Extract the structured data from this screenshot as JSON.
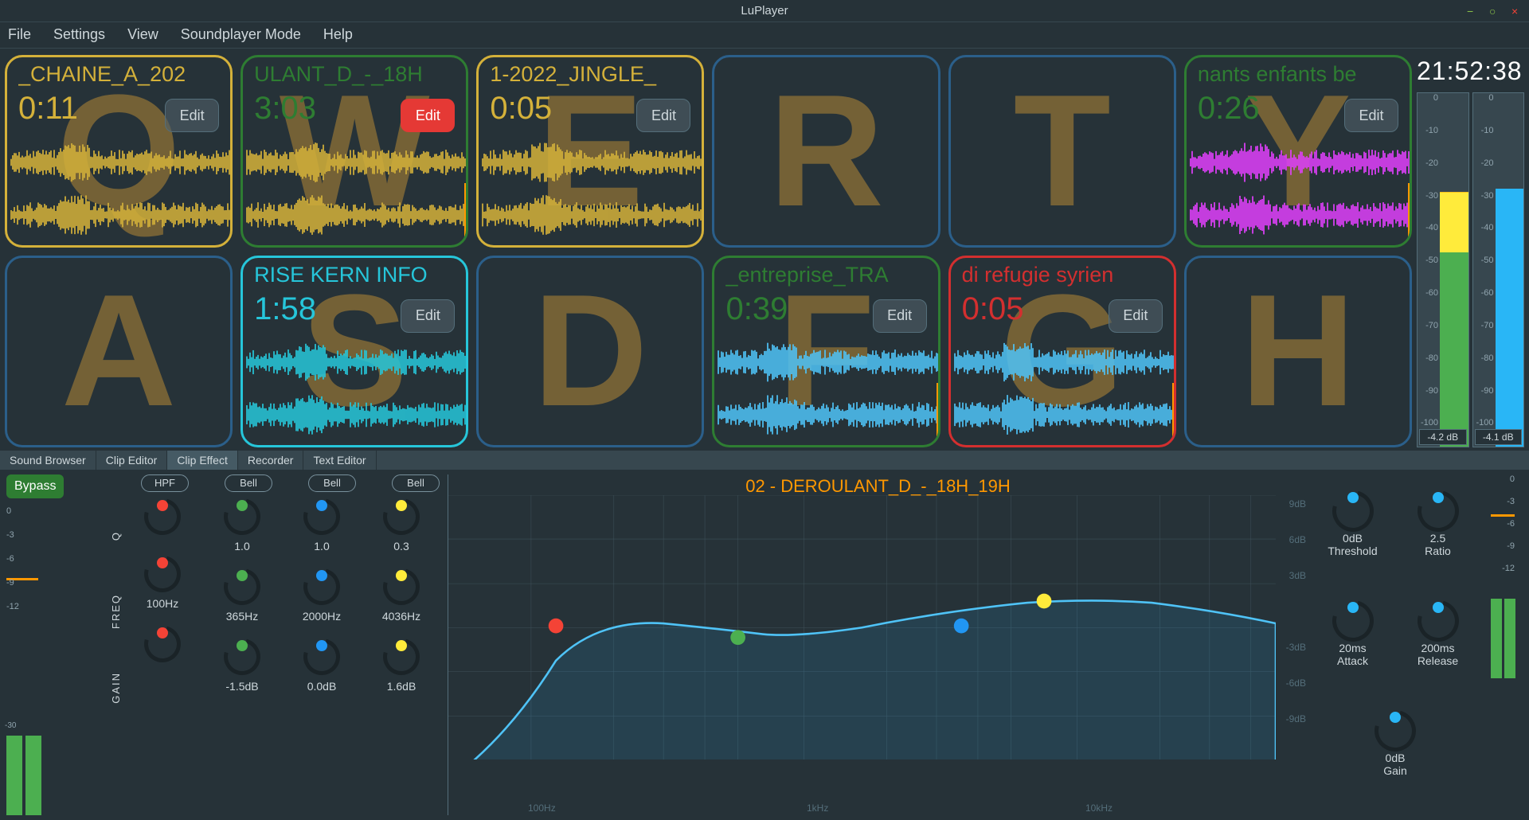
{
  "title": "LuPlayer",
  "menu": [
    "File",
    "Settings",
    "View",
    "Soundplayer Mode",
    "Help"
  ],
  "clock": "21:52:38",
  "meters": {
    "ticks": [
      "0",
      "-10",
      "-20",
      "-30",
      "-40",
      "-50",
      "-60",
      "-70",
      "-80",
      "-90",
      "-100"
    ],
    "left_db": "-4.2 dB",
    "right_db": "-4.1 dB"
  },
  "pads": [
    {
      "key": "Q",
      "title": "_CHAINE_A_202",
      "time": "0:11",
      "edit": "Edit",
      "cls": "yellow",
      "wave": "yellow"
    },
    {
      "key": "W",
      "title": "ULANT_D_-_18H",
      "time": "3:03",
      "edit": "Edit",
      "cls": "green",
      "wave": "yellow",
      "editRed": true,
      "lvl": true
    },
    {
      "key": "E",
      "title": "1-2022_JINGLE_",
      "time": "0:05",
      "edit": "Edit",
      "cls": "yellow",
      "wave": "yellow"
    },
    {
      "key": "R",
      "title": "",
      "time": "",
      "edit": "",
      "cls": "blue",
      "wave": ""
    },
    {
      "key": "T",
      "title": "",
      "time": "",
      "edit": "",
      "cls": "blue",
      "wave": ""
    },
    {
      "key": "Y",
      "title": "nants enfants be",
      "time": "0:26",
      "edit": "Edit",
      "cls": "green",
      "wave": "magenta",
      "titleGreen": true,
      "lvl": true
    },
    {
      "key": "A",
      "title": "",
      "time": "",
      "edit": "",
      "cls": "blue",
      "wave": ""
    },
    {
      "key": "S",
      "title": "RISE KERN INFO",
      "time": "1:58",
      "edit": "Edit",
      "cls": "cyan",
      "wave": "cyan"
    },
    {
      "key": "D",
      "title": "",
      "time": "",
      "edit": "",
      "cls": "blue",
      "wave": ""
    },
    {
      "key": "F",
      "title": "_entreprise_TRA",
      "time": "0:39",
      "edit": "Edit",
      "cls": "green",
      "wave": "blue",
      "lvl": true
    },
    {
      "key": "G",
      "title": "di refugie syrien",
      "time": "0:05",
      "edit": "Edit",
      "cls": "red",
      "wave": "blue",
      "lvl": true
    },
    {
      "key": "H",
      "title": "",
      "time": "",
      "edit": "",
      "cls": "blue",
      "wave": ""
    }
  ],
  "tabs": [
    "Sound Browser",
    "Clip Editor",
    "Clip Effect",
    "Recorder",
    "Text Editor"
  ],
  "active_tab": 2,
  "bypass": "Bypass",
  "trim_ticks": [
    "0",
    "-3",
    "-6",
    "-9",
    "-12"
  ],
  "eq_types": [
    "HPF",
    "Bell",
    "Bell",
    "Bell"
  ],
  "eq_row_labels": [
    "Q",
    "FREQ",
    "GAIN"
  ],
  "eq": [
    {
      "q": "",
      "freq": "100Hz",
      "gain": "",
      "dot": "dot-red"
    },
    {
      "q": "1.0",
      "freq": "365Hz",
      "gain": "-1.5dB",
      "dot": "dot-green"
    },
    {
      "q": "1.0",
      "freq": "2000Hz",
      "gain": "0.0dB",
      "dot": "dot-blue"
    },
    {
      "q": "0.3",
      "freq": "4036Hz",
      "gain": "1.6dB",
      "dot": "dot-yellow"
    }
  ],
  "eq_graph_title": "02 - DEROULANT_D_-_18H_19H",
  "db_labels": [
    "9dB",
    "6dB",
    "3dB",
    "-3dB",
    "-6dB",
    "-9dB"
  ],
  "hz_labels": [
    "100Hz",
    "1kHz",
    "10kHz"
  ],
  "comp": [
    {
      "val": "0dB",
      "label": "Threshold"
    },
    {
      "val": "2.5",
      "label": "Ratio"
    },
    {
      "val": "20ms",
      "label": "Attack"
    },
    {
      "val": "200ms",
      "label": "Release"
    },
    {
      "val": "0dB",
      "label": "Gain"
    }
  ],
  "r_ticks": [
    "0",
    "-3",
    "-6",
    "-9",
    "-12"
  ],
  "trim_meter_label": "-30"
}
